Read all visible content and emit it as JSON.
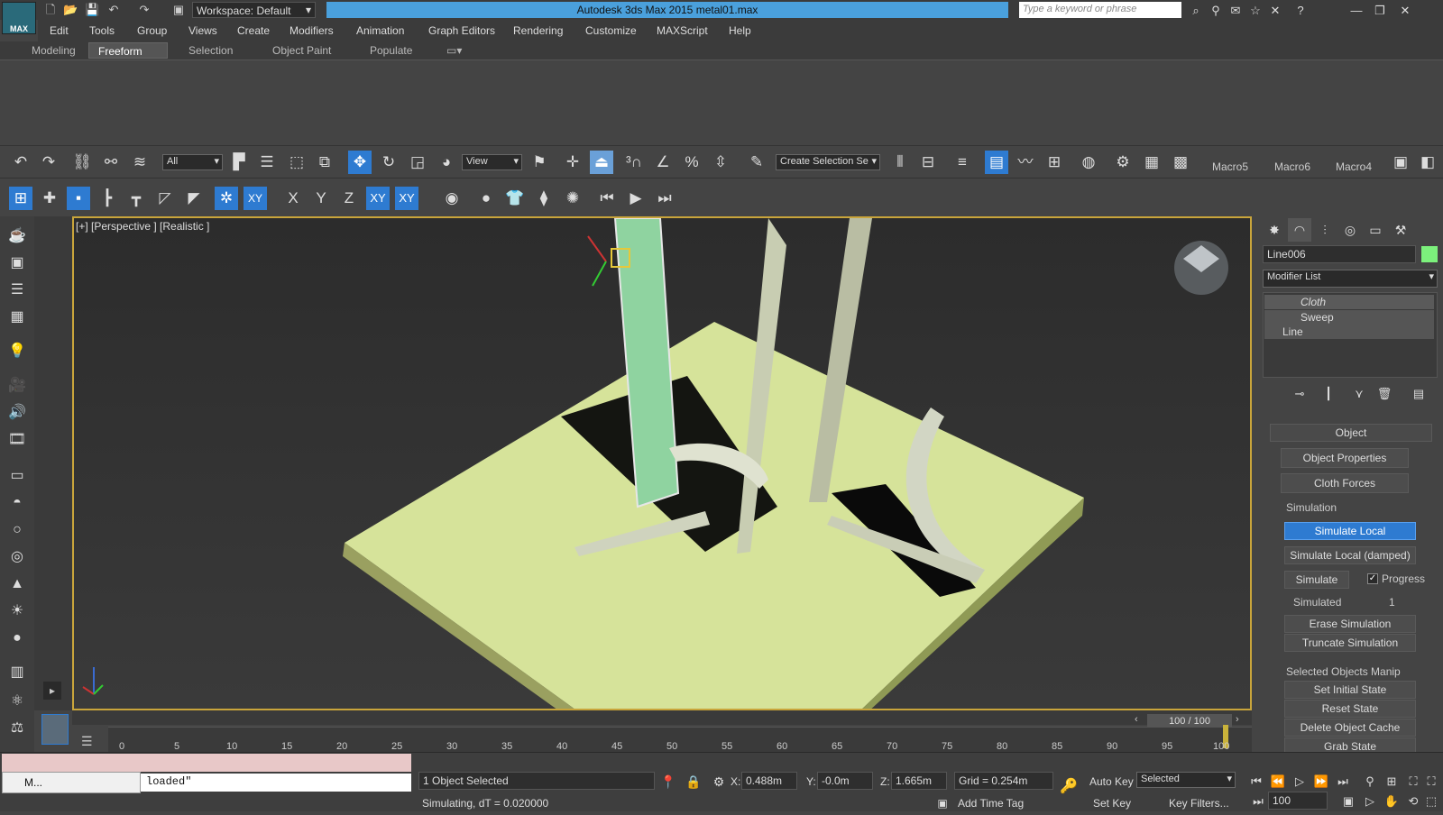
{
  "app": {
    "logo": "MAX",
    "title": "Autodesk 3ds Max  2015     metal01.max",
    "workspace": "Workspace: Default",
    "search_placeholder": "Type a keyword or phrase"
  },
  "menu": [
    "Edit",
    "Tools",
    "Group",
    "Views",
    "Create",
    "Modifiers",
    "Animation",
    "Graph Editors",
    "Rendering",
    "Customize",
    "MAXScript",
    "Help"
  ],
  "ribbon_tabs": [
    {
      "label": "Modeling"
    },
    {
      "label": "Freeform",
      "active": true
    },
    {
      "label": "Selection"
    },
    {
      "label": "Object Paint"
    },
    {
      "label": "Populate"
    }
  ],
  "toolbar": {
    "filter": "All",
    "refcoord": "View",
    "selection_set": "Create Selection Se",
    "macros": [
      "Macro5",
      "Macro6",
      "Macro4"
    ],
    "axis": [
      "X",
      "Y",
      "Z",
      "XY",
      "XY"
    ]
  },
  "viewport": {
    "label": "[+] [Perspective ] [Realistic ]"
  },
  "command": {
    "object_name": "Line006",
    "modifier_list": "Modifier List",
    "stack": [
      {
        "label": "Cloth",
        "italic": true
      },
      {
        "label": "Sweep"
      },
      {
        "label": "Line"
      }
    ],
    "rollout": "Object",
    "btn_props": "Object Properties",
    "btn_forces": "Cloth Forces",
    "sim_group": "Simulation",
    "sim_local": "Simulate Local",
    "sim_local_damped": "Simulate Local (damped)",
    "simulate": "Simulate",
    "progress": "Progress",
    "simulated_label": "Simulated",
    "simulated_value": "1",
    "erase": "Erase Simulation",
    "truncate": "Truncate Simulation",
    "manip_group": "Selected Objects Manip",
    "set_initial": "Set Initial State",
    "reset": "Reset State",
    "delete_cache": "Delete Object Cache",
    "grab": "Grab State"
  },
  "timeline": {
    "frame": "100 / 100",
    "ticks": [
      "0",
      "5",
      "10",
      "15",
      "20",
      "25",
      "30",
      "35",
      "40",
      "45",
      "50",
      "55",
      "60",
      "65",
      "70",
      "75",
      "80",
      "85",
      "90",
      "95",
      "100"
    ]
  },
  "status": {
    "script_text": "loaded\"",
    "mini": "M...",
    "selected": "1 Object Selected",
    "simulating": "Simulating, dT = 0.020000",
    "x_label": "X:",
    "x": "0.488m",
    "y_label": "Y:",
    "y": "-0.0m",
    "z_label": "Z:",
    "z": "1.665m",
    "grid": "Grid = 0.254m",
    "add_time_tag": "Add Time Tag",
    "auto_key": "Auto Key",
    "set_key": "Set Key",
    "selected_mode": "Selected",
    "key_filters": "Key Filters...",
    "frame_input": "100"
  },
  "colors": {
    "accent": "#2e7bd1",
    "title_bar": "#4aa0dc",
    "viewport_border": "#c9a53b",
    "ground": "#d6e39a"
  }
}
